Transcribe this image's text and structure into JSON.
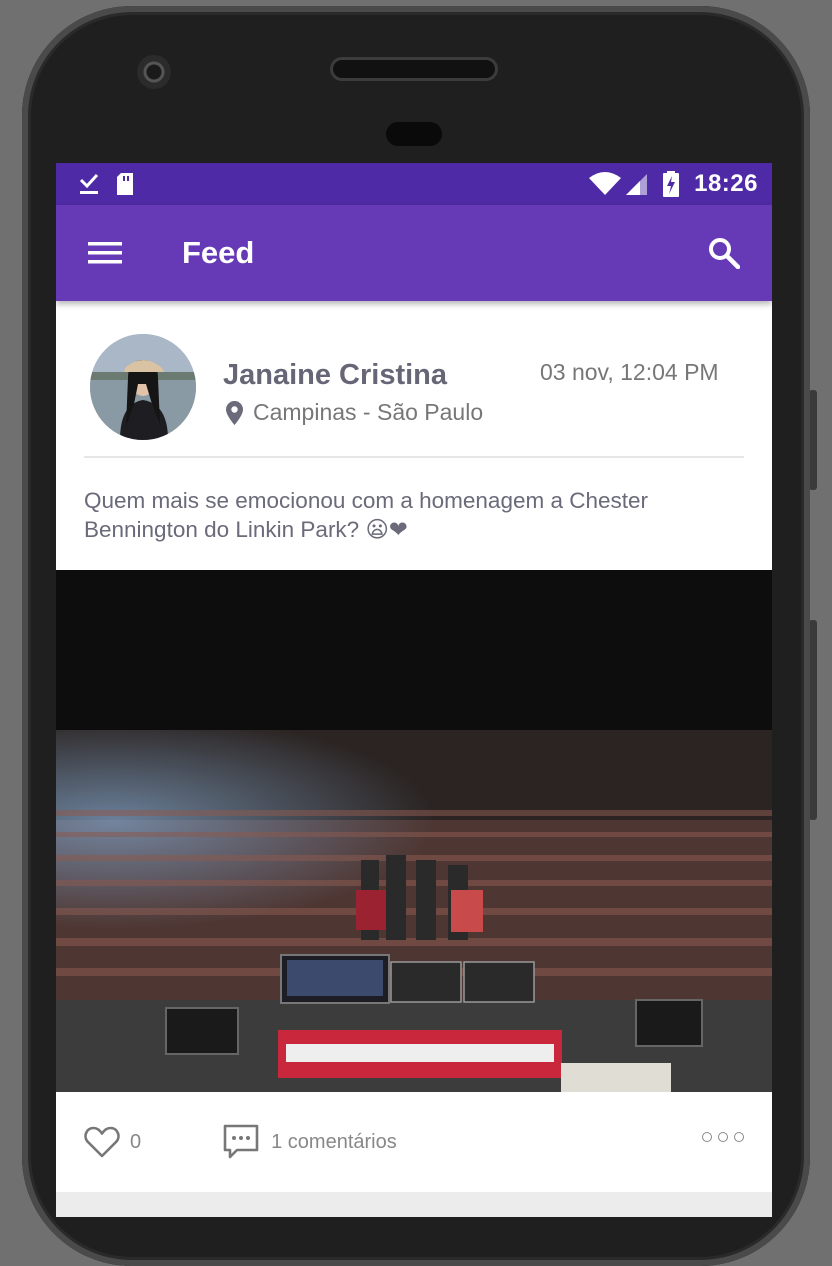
{
  "status_bar": {
    "time": "18:26"
  },
  "app_bar": {
    "title": "Feed"
  },
  "post": {
    "author": "Janaine Cristina",
    "timestamp": "03 nov, 12:04 PM",
    "location": "Campinas - São Paulo",
    "text": "Quem mais se emocionou com a homenagem a Chester Bennington do Linkin Park? 😦❤",
    "likes": "0",
    "comments": "1 comentários"
  },
  "colors": {
    "status_bar": "#4f2aa6",
    "app_bar": "#6639b6",
    "text_gray": "#777777"
  }
}
